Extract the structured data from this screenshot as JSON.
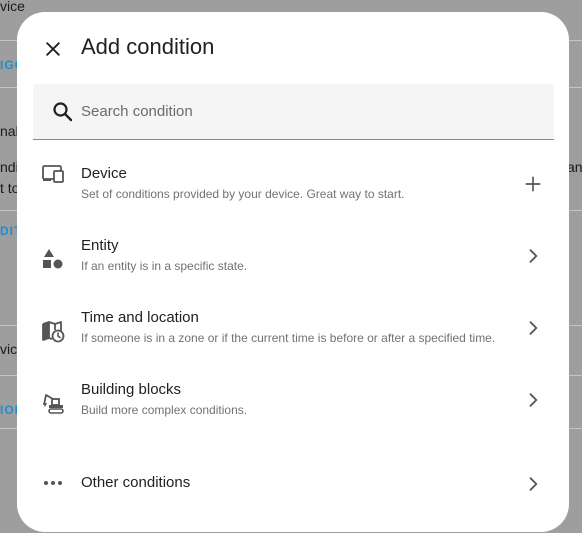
{
  "background": {
    "fragments": [
      "vice",
      "IGGE",
      "nal)",
      "nditio",
      "t to d",
      "DIT",
      "vice",
      "ION",
      "any"
    ]
  },
  "dialog": {
    "title": "Add condition",
    "close_icon": "close-icon",
    "search": {
      "placeholder": "Search condition",
      "value": ""
    },
    "items": [
      {
        "label": "Device",
        "description": "Set of conditions provided by your device. Great way to start.",
        "icon": "device-icon",
        "action_icon": "plus-icon"
      },
      {
        "label": "Entity",
        "description": "If an entity is in a specific state.",
        "icon": "shapes-icon",
        "action_icon": "chevron-right-icon"
      },
      {
        "label": "Time and location",
        "description": "If someone is in a zone or if the current time is before or after a specified time.",
        "icon": "map-clock-icon",
        "action_icon": "chevron-right-icon"
      },
      {
        "label": "Building blocks",
        "description": "Build more complex conditions.",
        "icon": "excavator-icon",
        "action_icon": "chevron-right-icon"
      },
      {
        "label": "Other conditions",
        "description": "",
        "icon": "dots-horizontal-icon",
        "action_icon": "chevron-right-icon"
      }
    ]
  },
  "colors": {
    "scrim": "#9e9e9e",
    "surface": "#ffffff",
    "search_fill": "#f5f5f5",
    "link_accent": "#1b8fcf",
    "icon": "#555555"
  }
}
